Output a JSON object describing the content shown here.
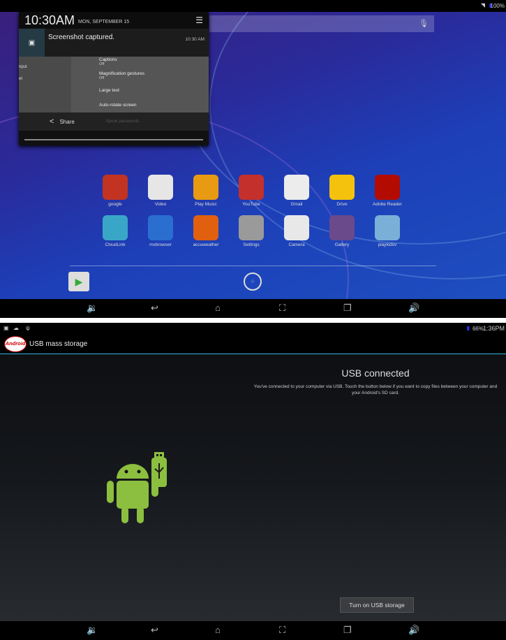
{
  "top_screen": {
    "status": {
      "battery": "100%"
    },
    "notification": {
      "time": "10:30AM",
      "date": "MON, SEPTEMBER 15",
      "title": "Screenshot captured.",
      "stamp": "10:30 AM",
      "share_label": "Share",
      "preview_left": [
        "nput",
        "et"
      ],
      "preview_items": [
        {
          "label": "Captions",
          "sub": "Off"
        },
        {
          "label": "Magnification gestures",
          "sub": "Off"
        },
        {
          "label": "Large text",
          "sub": ""
        },
        {
          "label": "Auto-rotate screen",
          "sub": ""
        },
        {
          "label": "Speak passwords",
          "sub": ""
        }
      ]
    },
    "apps": [
      {
        "label": "google",
        "color": "#c23321"
      },
      {
        "label": "Video",
        "color": "#e6e6e6"
      },
      {
        "label": "Play Music",
        "color": "#e89a12"
      },
      {
        "label": "YouTube",
        "color": "#c4302b"
      },
      {
        "label": "Gmail",
        "color": "#ececec"
      },
      {
        "label": "Drive",
        "color": "#f4c20d"
      },
      {
        "label": "Adobe Reader",
        "color": "#b30b00"
      },
      {
        "label": "CloudLink",
        "color": "#3aa6c7"
      },
      {
        "label": "mxbrowser",
        "color": "#2a6fd0"
      },
      {
        "label": "accuweather",
        "color": "#e06010"
      },
      {
        "label": "Settings",
        "color": "#9a9a9a"
      },
      {
        "label": "Camera",
        "color": "#e8e8e8"
      },
      {
        "label": "Gallery",
        "color": "#6a4a8a"
      },
      {
        "label": "playkidsv",
        "color": "#7ab0d8"
      }
    ]
  },
  "bottom_screen": {
    "status": {
      "battery": "66%",
      "time": "1:36PM"
    },
    "app_logo": "Android",
    "title": "USB mass storage",
    "heading": "USB connected",
    "description": "You've connected to your computer via USB. Touch the button below if you want to copy files between your computer and your Android's SD card.",
    "button": "Turn on USB storage",
    "accent": "#33b5e5",
    "android_green": "#8cbf3f"
  }
}
